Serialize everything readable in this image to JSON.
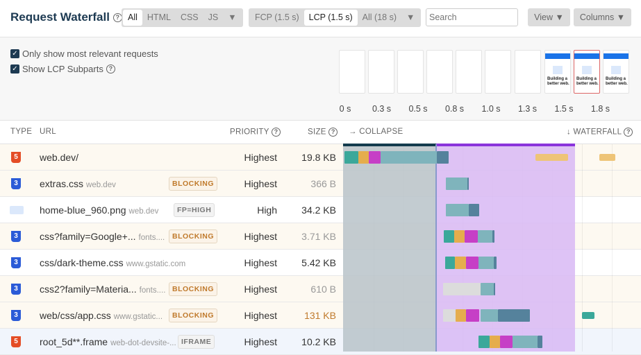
{
  "header": {
    "title": "Request Waterfall",
    "type_filters": [
      "All",
      "HTML",
      "CSS",
      "JS"
    ],
    "type_active": "All",
    "milestones": [
      "FCP (1.5 s)",
      "LCP (1.5 s)",
      "All (18 s)"
    ],
    "milestone_active": "LCP (1.5 s)",
    "search_placeholder": "Search",
    "view_label": "View ▼",
    "columns_label": "Columns ▼",
    "dropdown": "▼"
  },
  "options": {
    "relevant": "Only show most relevant requests",
    "lcp_subparts": "Show LCP Subparts"
  },
  "filmstrip": {
    "frame_text": "Building a better web.",
    "times": [
      "0 s",
      "0.3 s",
      "0.5 s",
      "0.8 s",
      "1.0 s",
      "1.3 s",
      "1.5 s",
      "1.8 s"
    ]
  },
  "table": {
    "headers": {
      "type": "TYPE",
      "url": "URL",
      "priority": "PRIORITY",
      "size": "SIZE",
      "collapse": "→ COLLAPSE",
      "waterfall": "↓ WATERFALL"
    },
    "rows": [
      {
        "type": "html",
        "url": "web.dev/",
        "domain": "",
        "badge": "",
        "priority": "Highest",
        "size": "19.8 KB"
      },
      {
        "type": "css",
        "url": "extras.css",
        "domain": "web.dev",
        "badge": "BLOCKING",
        "priority": "Highest",
        "size": "366 B"
      },
      {
        "type": "image",
        "url": "home-blue_960.png",
        "domain": "web.dev",
        "badge": "FP=HIGH",
        "priority": "High",
        "size": "34.2 KB"
      },
      {
        "type": "css",
        "url": "css?family=Google+...",
        "domain": "fonts....",
        "badge": "BLOCKING",
        "priority": "Highest",
        "size": "3.71 KB"
      },
      {
        "type": "css",
        "url": "css/dark-theme.css",
        "domain": "www.gstatic.com",
        "badge": "",
        "priority": "Highest",
        "size": "5.42 KB"
      },
      {
        "type": "css",
        "url": "css2?family=Materia...",
        "domain": "fonts....",
        "badge": "BLOCKING",
        "priority": "Highest",
        "size": "610 B"
      },
      {
        "type": "css",
        "url": "web/css/app.css",
        "domain": "www.gstatic...",
        "badge": "BLOCKING",
        "priority": "Highest",
        "size": "131 KB"
      },
      {
        "type": "html",
        "url": "root_5d**.frame",
        "domain": "web-dot-devsite-...",
        "badge": "IFRAME",
        "priority": "Highest",
        "size": "10.2 KB"
      }
    ]
  },
  "colors": {
    "html": "#e44d26",
    "css": "#2b5bd7",
    "lcp_overlay": "#d8b8f4",
    "fcp_overlay": "#b9c3c9",
    "accent": "#1d3a52"
  }
}
